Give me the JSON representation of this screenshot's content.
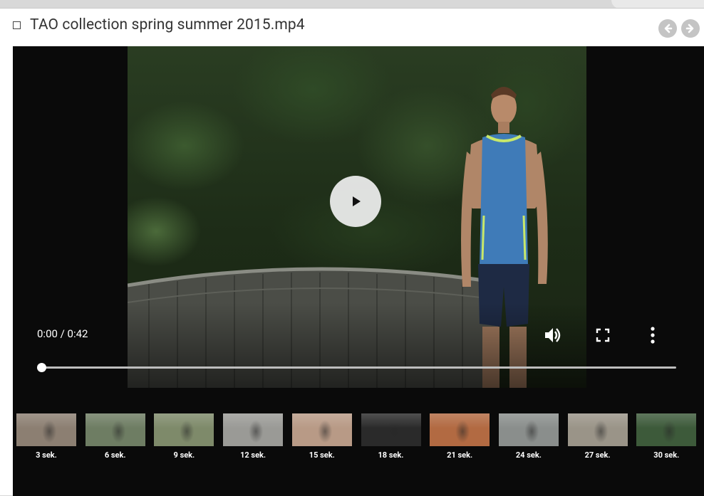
{
  "header": {
    "title": "TAO collection spring summer 2015.mp4",
    "prev_icon": "arrow-left-circle-icon",
    "next_icon": "arrow-right-circle-icon"
  },
  "player": {
    "time": "0:00 / 0:42",
    "progress_fraction": 0.0,
    "play_icon": "play-icon",
    "volume_icon": "volume-icon",
    "fullscreen_icon": "fullscreen-icon",
    "more_icon": "more-vert-icon"
  },
  "thumbnails": [
    {
      "label": "3 sek.",
      "scene": "track-runner",
      "color": "#8c7f72"
    },
    {
      "label": "6 sek.",
      "scene": "path-runner",
      "color": "#6e7d63"
    },
    {
      "label": "9 sek.",
      "scene": "orange-runner",
      "color": "#7e8a6a"
    },
    {
      "label": "12 sek.",
      "scene": "stairs-runner",
      "color": "#9a9a96"
    },
    {
      "label": "15 sek.",
      "scene": "woman-portrait",
      "color": "#b89a86"
    },
    {
      "label": "18 sek.",
      "scene": "shoe-closeup",
      "color": "#2a2a2a"
    },
    {
      "label": "21 sek.",
      "scene": "stretching",
      "color": "#b26a42"
    },
    {
      "label": "24 sek.",
      "scene": "city-track",
      "color": "#8a8e8c"
    },
    {
      "label": "27 sek.",
      "scene": "beach-runner",
      "color": "#9a9488"
    },
    {
      "label": "30 sek.",
      "scene": "blue-runner",
      "color": "#3d5a3a"
    }
  ],
  "colors": {
    "player_bg": "#0a0a0a",
    "nav_button": "#c4c4c4",
    "shirt": "#3f7bb8"
  }
}
